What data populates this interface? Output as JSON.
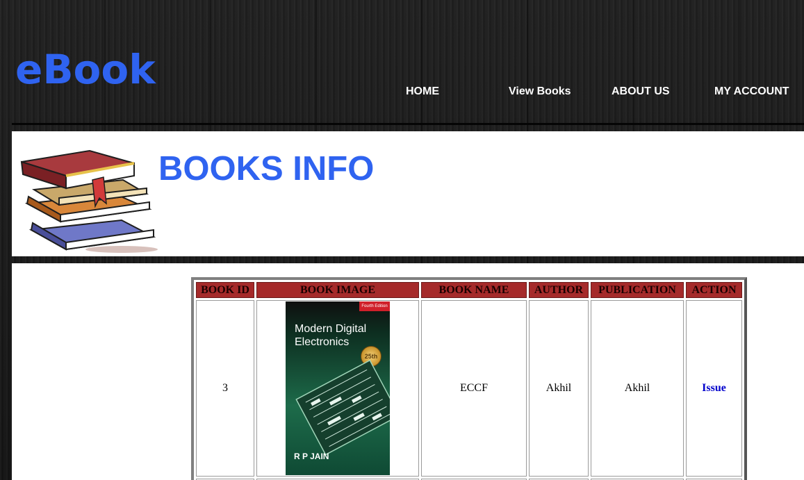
{
  "brand": {
    "logo": "eBook"
  },
  "nav": {
    "home": "HOME",
    "view_books": "View Books",
    "about": "ABOUT US",
    "account": "MY ACCOUNT"
  },
  "banner": {
    "title": "BOOKS INFO",
    "icon": "book-stack-icon"
  },
  "table": {
    "headers": [
      "BOOK ID",
      "BOOK IMAGE",
      "BOOK NAME",
      "AUTHOR",
      "PUBLICATION",
      "ACTION"
    ],
    "rows": [
      {
        "id": "3",
        "image": {
          "title": "Modern Digital Electronics",
          "edition": "Fourth Edition",
          "seal": "25th",
          "author": "R P JAIN"
        },
        "name": "ECCF",
        "author": "Akhil",
        "publication": "Akhil",
        "action": "Issue"
      }
    ]
  },
  "colors": {
    "brand_blue": "#2f63f0",
    "header_cell": "#a52a2a",
    "link": "#0000cc"
  }
}
